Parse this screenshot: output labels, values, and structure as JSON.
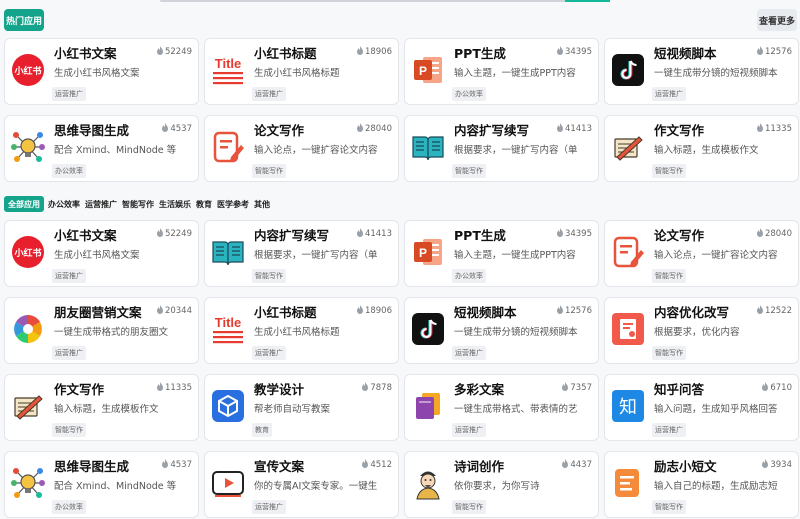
{
  "header": {
    "hot_label": "热门应用",
    "more_label": "查看更多"
  },
  "categories": {
    "all_label": "全部应用",
    "items": [
      "办公效率",
      "运营推广",
      "智能写作",
      "生活娱乐",
      "教育",
      "医学参考",
      "其他"
    ]
  },
  "hot_apps": [
    {
      "title": "小红书文案",
      "count": "52249",
      "desc": "生成小红书风格文案",
      "tag": "运营推广",
      "icon": "xiaohongshu-icon"
    },
    {
      "title": "小红书标题",
      "count": "18906",
      "desc": "生成小红书风格标题",
      "tag": "运营推广",
      "icon": "title-icon"
    },
    {
      "title": "PPT生成",
      "count": "34395",
      "desc": "输入主题，一键生成PPT内容",
      "tag": "办公效率",
      "icon": "powerpoint-icon"
    },
    {
      "title": "短视频脚本",
      "count": "12576",
      "desc": "一键生成带分镜的短视频脚本",
      "tag": "运营推广",
      "icon": "tiktok-icon"
    },
    {
      "title": "思维导图生成",
      "count": "4537",
      "desc": "配合 Xmind、MindNode 等",
      "tag": "办公效率",
      "icon": "mindmap-icon"
    },
    {
      "title": "论文写作",
      "count": "28040",
      "desc": "输入论点，一键扩容论文内容",
      "tag": "智能写作",
      "icon": "edit-doc-icon"
    },
    {
      "title": "内容扩写续写",
      "count": "41413",
      "desc": "根据要求，一键扩写内容（单",
      "tag": "智能写作",
      "icon": "open-book-icon"
    },
    {
      "title": "作文写作",
      "count": "11335",
      "desc": "输入标题，生成模板作文",
      "tag": "智能写作",
      "icon": "notebook-pencil-icon"
    }
  ],
  "all_apps": [
    {
      "title": "小红书文案",
      "count": "52249",
      "desc": "生成小红书风格文案",
      "tag": "运营推广",
      "icon": "xiaohongshu-icon"
    },
    {
      "title": "内容扩写续写",
      "count": "41413",
      "desc": "根据要求，一键扩写内容（单",
      "tag": "智能写作",
      "icon": "open-book-icon"
    },
    {
      "title": "PPT生成",
      "count": "34395",
      "desc": "输入主题，一键生成PPT内容",
      "tag": "办公效率",
      "icon": "powerpoint-icon"
    },
    {
      "title": "论文写作",
      "count": "28040",
      "desc": "输入论点，一键扩容论文内容",
      "tag": "智能写作",
      "icon": "edit-doc-icon"
    },
    {
      "title": "朋友圈营销文案",
      "count": "20344",
      "desc": "一键生成带格式的朋友圈文",
      "tag": "运营推广",
      "icon": "moments-icon"
    },
    {
      "title": "小红书标题",
      "count": "18906",
      "desc": "生成小红书风格标题",
      "tag": "运营推广",
      "icon": "title-icon"
    },
    {
      "title": "短视频脚本",
      "count": "12576",
      "desc": "一键生成带分镜的短视频脚本",
      "tag": "运营推广",
      "icon": "tiktok-icon"
    },
    {
      "title": "内容优化改写",
      "count": "12522",
      "desc": "根据要求，优化内容",
      "tag": "智能写作",
      "icon": "document-icon"
    },
    {
      "title": "作文写作",
      "count": "11335",
      "desc": "输入标题，生成模板作文",
      "tag": "智能写作",
      "icon": "notebook-pencil-icon"
    },
    {
      "title": "教学设计",
      "count": "7878",
      "desc": "帮老师自动写教案",
      "tag": "教育",
      "icon": "cube-icon"
    },
    {
      "title": "多彩文案",
      "count": "7357",
      "desc": "一键生成带格式、带表情的艺",
      "tag": "运营推广",
      "icon": "colorful-cards-icon"
    },
    {
      "title": "知乎问答",
      "count": "6710",
      "desc": "输入问题，生成知乎风格回答",
      "tag": "运营推广",
      "icon": "zhihu-icon"
    },
    {
      "title": "思维导图生成",
      "count": "4537",
      "desc": "配合 Xmind、MindNode 等",
      "tag": "办公效率",
      "icon": "mindmap-icon"
    },
    {
      "title": "宣传文案",
      "count": "4512",
      "desc": "你的专属AI文案专家。一键生",
      "tag": "运营推广",
      "icon": "video-play-icon"
    },
    {
      "title": "诗词创作",
      "count": "4437",
      "desc": "依你要求，为你写诗",
      "tag": "智能写作",
      "icon": "poet-icon"
    },
    {
      "title": "励志小短文",
      "count": "3934",
      "desc": "输入自己的标题，生成励志短",
      "tag": "智能写作",
      "icon": "orange-doc-icon"
    }
  ]
}
